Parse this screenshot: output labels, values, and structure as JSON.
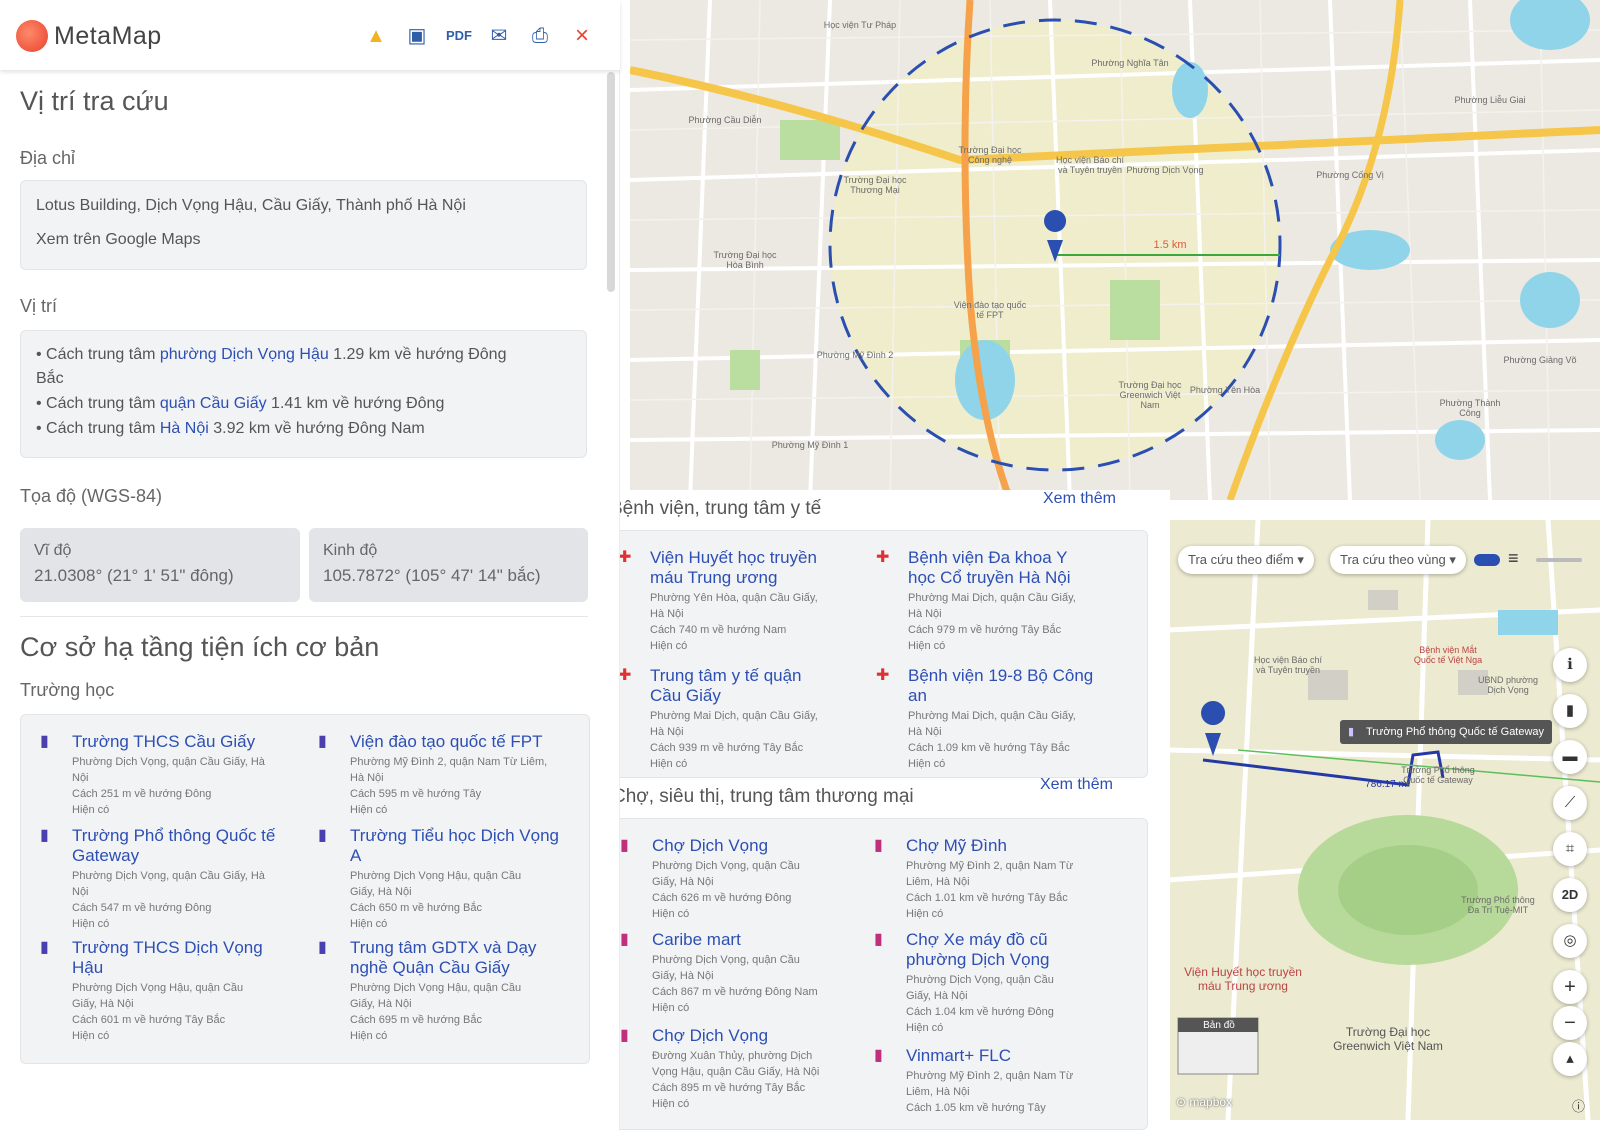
{
  "app": {
    "name": "MetaMap"
  },
  "toolbar": {
    "icons": [
      "warning-icon",
      "report-icon",
      "pdf-icon",
      "email-icon",
      "print-icon",
      "close-icon"
    ]
  },
  "location": {
    "title": "Vị trí tra cứu",
    "address_label": "Địa chỉ",
    "address": "Lotus Building, Dịch Vọng Hậu, Cầu Giấy, Thành phố Hà Nội",
    "google_maps_link": "Xem trên Google Maps",
    "position_label": "Vị trí",
    "position_items": [
      {
        "prefix": "Cách trung tâm ",
        "link": "phường Dịch Vọng Hậu",
        "suffix": " 1.29 km về hướng Đông",
        "suffix2": "Bắc"
      },
      {
        "prefix": "Cách trung tâm ",
        "link": "quận Cầu Giấy",
        "suffix": " 1.41 km về hướng Đông"
      },
      {
        "prefix": "Cách trung tâm ",
        "link": "Hà Nội",
        "suffix": " 3.92 km về hướng Đông Nam"
      }
    ],
    "coords_label": "Tọa độ (WGS-84)",
    "lat_label": "Vĩ độ",
    "lat_value": "21.0308° (21° 1' 51\" đông)",
    "lng_label": "Kinh độ",
    "lng_value": "105.7872° (105° 47' 14\" bắc)"
  },
  "infra": {
    "title": "Cơ sở hạ tầng tiện ích cơ bản",
    "schools_label": "Trường học",
    "schools": [
      {
        "name": [
          "Trường THCS Cầu Giấy"
        ],
        "addr": [
          "Phường Dịch Vọng, quận Cầu Giấy, Hà",
          "Nội"
        ],
        "dist": "Cách 251 m về hướng Đông",
        "status": "Hiện có"
      },
      {
        "name": [
          "Viện đào tạo quốc tế FPT"
        ],
        "addr": [
          "Phường Mỹ Đình 2, quận Nam Từ Liêm,",
          "Hà Nội"
        ],
        "dist": "Cách 595 m về hướng Tây",
        "status": "Hiện có"
      },
      {
        "name": [
          "Trường Phổ thông Quốc tế",
          "Gateway"
        ],
        "addr": [
          "Phường Dịch Vọng, quận Cầu Giấy, Hà",
          "Nội"
        ],
        "dist": "Cách 547 m về hướng Đông",
        "status": "Hiện có"
      },
      {
        "name": [
          "Trường Tiểu học Dịch Vọng",
          "A"
        ],
        "addr": [
          "Phường Dịch Vọng Hậu, quận Cầu",
          "Giấy, Hà Nội"
        ],
        "dist": "Cách 650 m về hướng Bắc",
        "status": "Hiện có"
      },
      {
        "name": [
          "Trường THCS Dịch Vọng",
          "Hậu"
        ],
        "addr": [
          "Phường Dịch Vọng Hậu, quận Cầu",
          "Giấy, Hà Nội"
        ],
        "dist": "Cách 601 m về hướng Tây Bắc",
        "status": "Hiện có"
      },
      {
        "name": [
          "Trung tâm GDTX và Dạy",
          "nghề Quận Cầu Giấy"
        ],
        "addr": [
          "Phường Dịch Vọng Hậu, quận Cầu",
          "Giấy, Hà Nội"
        ],
        "dist": "Cách 695 m về hướng Bắc",
        "status": "Hiện có"
      }
    ]
  },
  "hospitals": {
    "title": "Bệnh viện, trung tâm y tế",
    "see_more": "Xem thêm",
    "items": [
      {
        "name": [
          "Viện Huyết học truyền",
          "máu Trung ương"
        ],
        "addr": [
          "Phường Yên Hòa, quận Cầu Giấy,",
          "Hà Nội"
        ],
        "dist": "Cách 740 m về hướng Nam",
        "status": "Hiện có"
      },
      {
        "name": [
          "Bệnh viện Đa khoa Y",
          "học Cổ truyền Hà Nội"
        ],
        "addr": [
          "Phường Mai Dịch, quận Cầu Giấy,",
          "Hà Nội"
        ],
        "dist": "Cách 979 m về hướng Tây Bắc",
        "status": "Hiện có"
      },
      {
        "name": [
          "Trung tâm y tế quận",
          "Cầu Giấy"
        ],
        "addr": [
          "Phường Mai Dịch, quận Cầu Giấy,",
          "Hà Nội"
        ],
        "dist": "Cách 939 m về hướng Tây Bắc",
        "status": "Hiện có"
      },
      {
        "name": [
          "Bệnh viện 19-8 Bộ Công",
          "an"
        ],
        "addr": [
          "Phường Mai Dịch, quận Cầu Giấy,",
          "Hà Nội"
        ],
        "dist": "Cách 1.09 km về hướng Tây Bắc",
        "status": "Hiện có"
      }
    ]
  },
  "markets": {
    "title": "Chợ, siêu thị, trung tâm thương mại",
    "see_more": "Xem thêm",
    "items": [
      {
        "name": [
          "Chợ Dịch Vọng"
        ],
        "addr": [
          "Phường Dịch Vọng, quận Cầu",
          "Giấy, Hà Nội"
        ],
        "dist": "Cách 626 m về hướng Đông",
        "status": "Hiện có"
      },
      {
        "name": [
          "Chợ Mỹ Đình"
        ],
        "addr": [
          "Phường Mỹ Đình 2, quận Nam Từ",
          "Liêm, Hà Nội"
        ],
        "dist": "Cách 1.01 km về hướng Tây Bắc",
        "status": "Hiện có"
      },
      {
        "name": [
          "Caribe mart"
        ],
        "addr": [
          "Phường Dịch Vọng, quận Cầu",
          "Giấy, Hà Nội"
        ],
        "dist": "Cách 867 m về hướng Đông Nam",
        "status": "Hiện có"
      },
      {
        "name": [
          "Chợ Xe máy đồ cũ",
          "phường Dịch Vọng"
        ],
        "addr": [
          "Phường Dịch Vọng, quận Cầu",
          "Giấy, Hà Nội"
        ],
        "dist": "Cách 1.04 km về hướng Đông",
        "status": "Hiện có"
      },
      {
        "name": [
          "Chợ Dịch Vọng"
        ],
        "addr": [
          "Đường Xuân Thủy, phường Dịch",
          "Vọng Hậu, quận Cầu Giấy, Hà Nội"
        ],
        "dist": "Cách 895 m về hướng Tây Bắc",
        "status": "Hiện có"
      },
      {
        "name": [
          "Vinmart+ FLC"
        ],
        "addr": [
          "Phường Mỹ Đình 2, quận Nam Từ",
          "Liêm, Hà Nội"
        ],
        "dist": "Cách 1.05 km về hướng Tây",
        "status": ""
      }
    ]
  },
  "map_top": {
    "distance_label": "1.5 km",
    "labels": [
      "Phường Nghĩa Tân",
      "Phường Cầu Diễn",
      "Phường Dịch Vọng",
      "Phường Mỹ Đình 2",
      "Phường Mỹ Đình 1",
      "Phường Yên Hòa",
      "Phường Giảng Võ",
      "Phường Thành Công",
      "Phường Cống Vị",
      "Phường Liễu Giai",
      "Học viện Tư Pháp",
      "Học viện Báo chí và Tuyên truyền",
      "Viện đào tạo quốc tế FPT",
      "Trường Đại học Greenwich Việt Nam",
      "Trường Đại học Thương Mại",
      "Trường Đại học Hòa Bình",
      "Trường Đại học Công nghệ"
    ]
  },
  "map_bottom": {
    "mode_point": "Tra cứu theo điểm",
    "mode_area": "Tra cứu theo vùng",
    "tooltip": "Trường Phổ thông Quốc tế Gateway",
    "route_label": "786.17 m",
    "labels": [
      "Viện Huyết học truyền máu Trung ương",
      "Trường Đại học Greenwich Việt Nam",
      "Học viện Báo chí và Tuyên truyền",
      "Bệnh viện Mắt Quốc tế Việt Nga",
      "UBND phường Dịch Vọng",
      "Trường Phổ thông Quốc tế Gateway",
      "Trường Phổ thông Đa Trí Tuệ-MIT"
    ],
    "btn_2d": "2D",
    "zoom_in": "+",
    "zoom_out": "−",
    "basemap_label": "Bản đồ",
    "attribution": "mapbox"
  }
}
